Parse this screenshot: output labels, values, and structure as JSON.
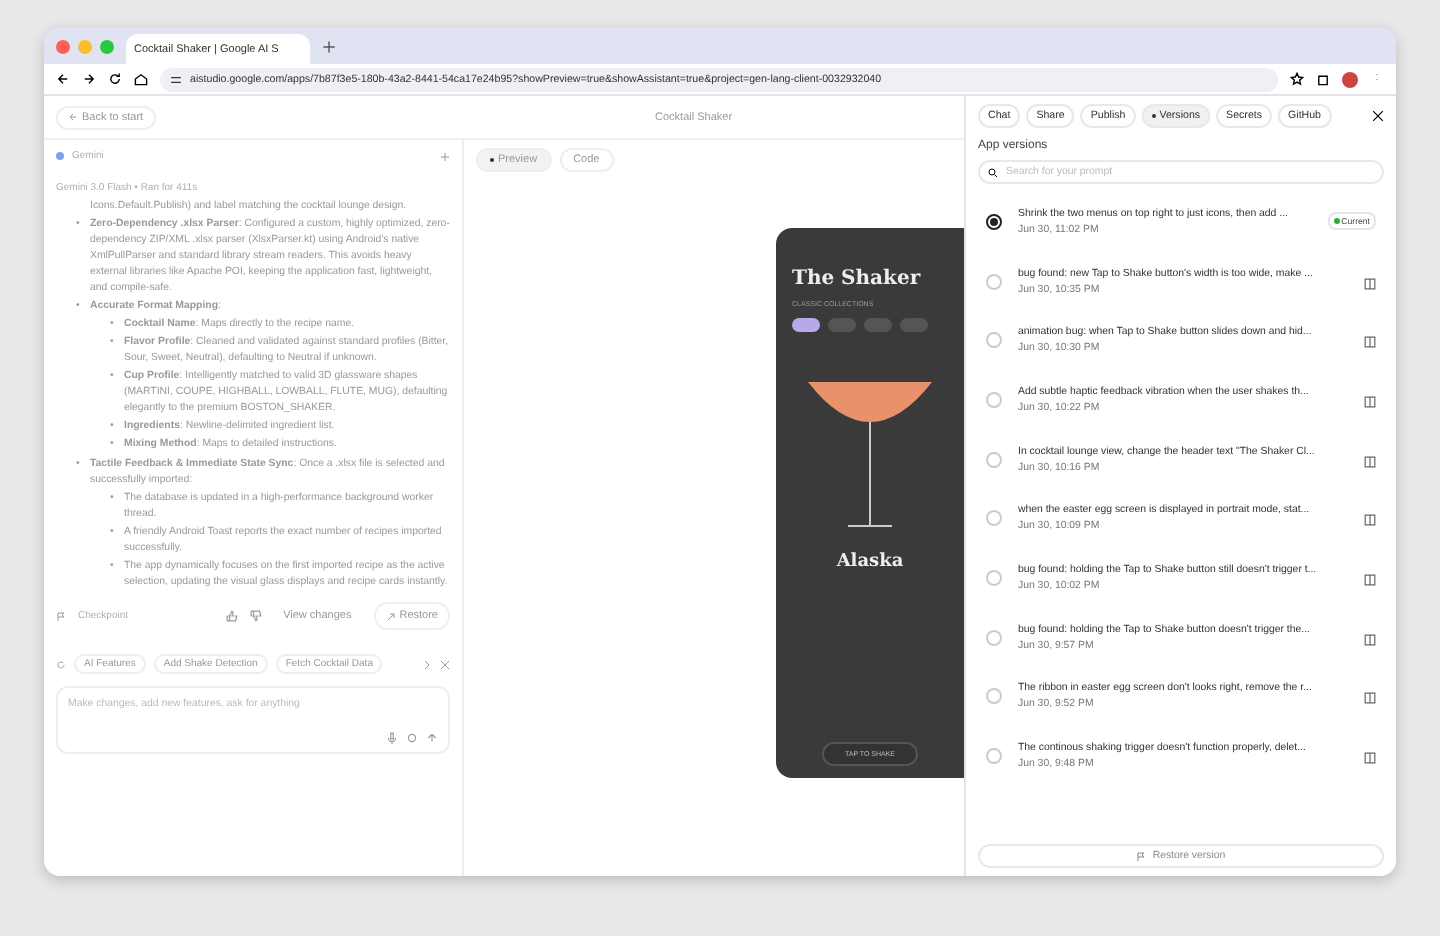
{
  "browser": {
    "tab_title": "Cocktail Shaker | Google AI S",
    "url": "aistudio.google.com/apps/7b87f3e5-180b-43a2-8441-54ca17e24b95?showPreview=true&showAssistant=true&project=gen-lang-client-0032932040"
  },
  "header": {
    "back": "Back to start",
    "title": "Cocktail Shaker"
  },
  "chat": {
    "agent": "Gemini",
    "meta": "Gemini 3.0 Flash • Ran for 411s",
    "items": [
      {
        "text": "Icons.Default.Publish) and label matching the cocktail lounge design."
      },
      {
        "marker": "•",
        "text": "**Zero-Dependency .xlsx Parser**: Configured a custom, highly optimized, zero-dependency ZIP/XML .xlsx parser (XlsxParser.kt) using Android's native XmlPullParser and standard library stream readers. This avoids heavy external libraries like Apache POI, keeping the application fast, lightweight, and compile-safe."
      },
      {
        "marker": "•",
        "text": "**Accurate Format Mapping**:",
        "children": [
          {
            "marker": "•",
            "text": "**Cocktail Name**: Maps directly to the recipe name."
          },
          {
            "marker": "•",
            "text": "**Flavor Profile**: Cleaned and validated against standard profiles (Bitter, Sour, Sweet, Neutral), defaulting to Neutral if unknown."
          },
          {
            "marker": "•",
            "text": "**Cup Profile**: Intelligently matched to valid 3D glassware shapes (MARTINI, COUPE, HIGHBALL, LOWBALL, FLUTE, MUG), defaulting elegantly to the premium BOSTON_SHAKER."
          },
          {
            "marker": "•",
            "text": "**Ingredients**: Newline-delimited ingredient list."
          },
          {
            "marker": "•",
            "text": "**Mixing Method**: Maps to detailed instructions."
          }
        ]
      },
      {
        "marker": "•",
        "text": "**Tactile Feedback & Immediate State Sync**: Once a .xlsx file is selected and successfully imported:",
        "children": [
          {
            "marker": "•",
            "text": "The database is updated in a high-performance background worker thread."
          },
          {
            "marker": "•",
            "text": "A friendly Android Toast reports the exact number of recipes imported successfully."
          },
          {
            "marker": "•",
            "text": "The app dynamically focuses on the first imported recipe as the active selection, updating the visual glass displays and recipe cards instantly."
          }
        ]
      }
    ],
    "checkpoint": "Checkpoint",
    "view_changes": "View changes",
    "restore": "Restore",
    "suggestions": [
      "AI Features",
      "Add Shake Detection",
      "Fetch Cocktail Data"
    ],
    "input": {
      "placeholder": "Make changes, add new features, ask for anything"
    }
  },
  "preview": {
    "tabs": [
      {
        "label": "Preview",
        "selected": true
      },
      {
        "label": "Code",
        "selected": false
      }
    ],
    "phone": {
      "title": "The Shaker",
      "subtitle": "CLASSIC COLLECTIONS",
      "chips": [
        {
          "selected": true
        },
        {
          "selected": false
        },
        {
          "selected": false
        },
        {
          "selected": false
        }
      ],
      "cocktail": "Alaska",
      "shake_button": "TAP TO SHAKE"
    }
  },
  "panel": {
    "tabs": [
      {
        "label": "Chat",
        "selected": false
      },
      {
        "label": "Share",
        "selected": false
      },
      {
        "label": "Publish",
        "selected": false
      },
      {
        "label": "Versions",
        "selected": true
      },
      {
        "label": "Secrets",
        "selected": false
      },
      {
        "label": "GitHub",
        "selected": false
      }
    ],
    "heading": "App versions",
    "search": {
      "placeholder": "Search for your prompt"
    },
    "versions": [
      {
        "prompt": "Shrink the two menus on top right to just icons, then add ...",
        "time": "Jun 30, 11:02 PM",
        "selected": true,
        "badge": "Current"
      },
      {
        "prompt": "bug found: new Tap to Shake button's width is too wide, make ...",
        "time": "Jun 30, 10:35 PM",
        "selected": false
      },
      {
        "prompt": "animation bug: when Tap to Shake button slides down and hid...",
        "time": "Jun 30, 10:30 PM",
        "selected": false
      },
      {
        "prompt": "Add subtle haptic feedback vibration when the user shakes th...",
        "time": "Jun 30, 10:22 PM",
        "selected": false
      },
      {
        "prompt": "In cocktail lounge view, change the header text \"The Shaker Cl...",
        "time": "Jun 30, 10:16 PM",
        "selected": false
      },
      {
        "prompt": "when the easter egg screen is displayed in portrait mode, stat...",
        "time": "Jun 30, 10:09 PM",
        "selected": false
      },
      {
        "prompt": "bug found: holding the Tap to Shake button still doesn't trigger t...",
        "time": "Jun 30, 10:02 PM",
        "selected": false
      },
      {
        "prompt": "bug found: holding the Tap to Shake button doesn't trigger the...",
        "time": "Jun 30, 9:57 PM",
        "selected": false
      },
      {
        "prompt": "The ribbon in easter egg screen don't looks right, remove the r...",
        "time": "Jun 30, 9:52 PM",
        "selected": false
      },
      {
        "prompt": "The continous shaking trigger doesn't function properly, delet...",
        "time": "Jun 30, 9:48 PM",
        "selected": false
      }
    ],
    "restore": "Restore version"
  }
}
